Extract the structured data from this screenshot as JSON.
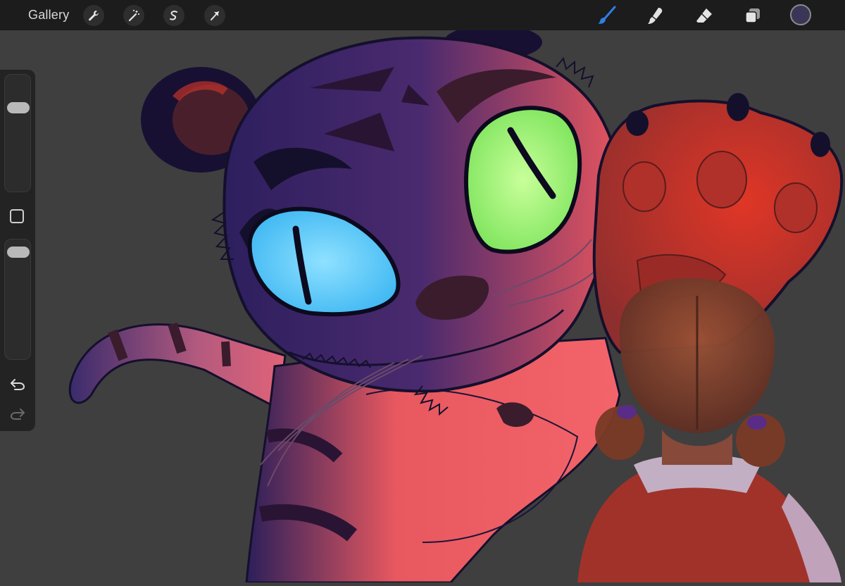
{
  "toolbar": {
    "gallery_label": "Gallery",
    "left_tools": [
      {
        "name": "actions",
        "icon": "wrench-icon"
      },
      {
        "name": "adjustments",
        "icon": "magic-wand-icon"
      },
      {
        "name": "selection",
        "icon": "selection-s-icon"
      },
      {
        "name": "transform",
        "icon": "arrow-cursor-icon"
      }
    ],
    "right_tools": [
      {
        "name": "brush",
        "icon": "brush-icon",
        "active": true,
        "color": "#2f7fe6"
      },
      {
        "name": "smudge",
        "icon": "smudge-icon"
      },
      {
        "name": "eraser",
        "icon": "eraser-icon"
      },
      {
        "name": "layers",
        "icon": "layers-icon"
      }
    ],
    "current_color": "#3a3658"
  },
  "sidebar": {
    "brush_size_level": 0.75,
    "opacity_level": 0.95,
    "modifier_icon": "square-modifier-icon",
    "undo_icon": "undo-icon",
    "redo_icon": "redo-icon"
  },
  "canvas": {
    "background": "#3f3f3f",
    "artwork": "tiger-illustration"
  }
}
